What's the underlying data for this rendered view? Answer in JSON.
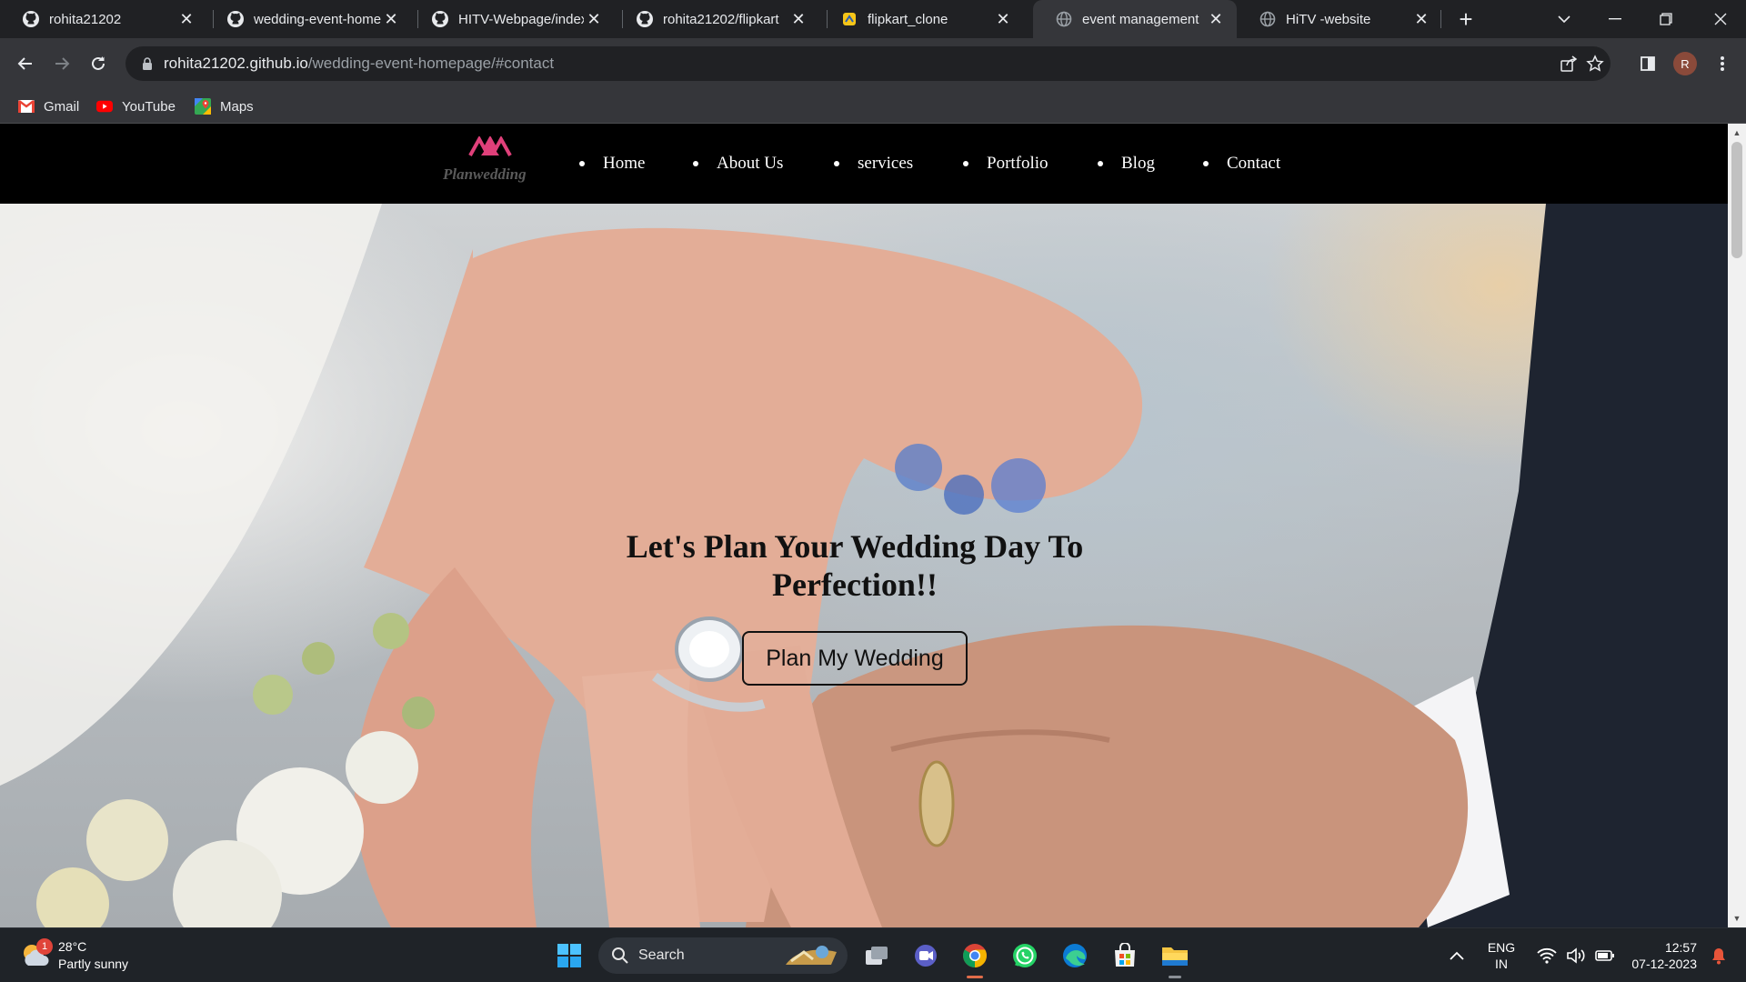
{
  "browser": {
    "tabs": [
      {
        "title": "rohita21202",
        "icon": "github-icon",
        "active": false
      },
      {
        "title": "wedding-event-homepage",
        "icon": "github-icon",
        "active": false
      },
      {
        "title": "HITV-Webpage/index",
        "icon": "github-icon",
        "active": false
      },
      {
        "title": "rohita21202/flipkart",
        "icon": "github-icon",
        "active": false
      },
      {
        "title": "flipkart_clone",
        "icon": "replit-icon",
        "active": false
      },
      {
        "title": "event management",
        "icon": "globe-icon",
        "active": true
      },
      {
        "title": "HiTV -website",
        "icon": "globe-icon",
        "active": false
      }
    ],
    "address": {
      "host": "rohita21202.github.io",
      "path": "/wedding-event-homepage/#contact"
    },
    "profile_initial": "R",
    "bookmarks": [
      {
        "label": "Gmail",
        "icon": "gmail-icon"
      },
      {
        "label": "YouTube",
        "icon": "youtube-icon"
      },
      {
        "label": "Maps",
        "icon": "maps-icon"
      }
    ]
  },
  "site": {
    "logo_text": "Planwedding",
    "brand_color": "#e0407a",
    "nav": [
      "Home",
      "About Us",
      "services",
      "Portfolio",
      "Blog",
      "Contact"
    ],
    "hero": {
      "title": "Let's Plan Your Wedding Day To Perfection!!",
      "button": "Plan My Wedding"
    }
  },
  "taskbar": {
    "weather": {
      "temp": "28°C",
      "condition": "Partly sunny",
      "badge": "1"
    },
    "search_placeholder": "Search",
    "apps": [
      "windows-start-icon",
      "task-view-icon",
      "meet-icon",
      "chrome-icon",
      "whatsapp-icon",
      "edge-icon",
      "microsoft-store-icon",
      "file-explorer-icon"
    ],
    "language": {
      "line1": "ENG",
      "line2": "IN"
    },
    "clock": {
      "time": "12:57",
      "date": "07-12-2023"
    }
  }
}
